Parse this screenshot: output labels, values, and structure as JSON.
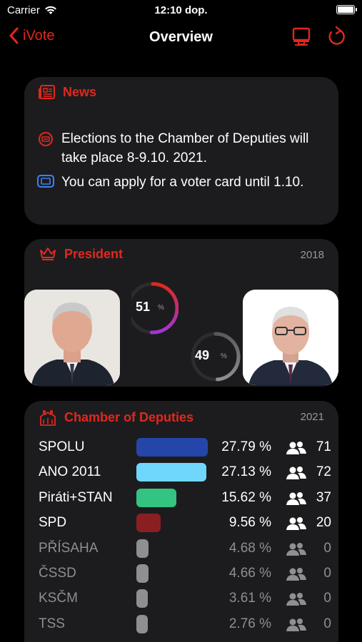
{
  "status_bar": {
    "carrier": "Carrier",
    "time": "12:10 dop."
  },
  "nav": {
    "back_label": "iVote",
    "title": "Overview"
  },
  "news": {
    "title": "News",
    "items": [
      {
        "icon": "ballot-icon",
        "text": "Elections to the Chamber of Deputies will take place 8-9.10. 2021."
      },
      {
        "icon": "voter-card-icon",
        "text": "You can apply for a voter card until 1.10."
      }
    ]
  },
  "president": {
    "title": "President",
    "year": "2018",
    "candidates": [
      {
        "value": "51",
        "unit": "%",
        "share": 0.51,
        "color": "#a035d6"
      },
      {
        "value": "49",
        "unit": "%",
        "share": 0.49,
        "color": "#8e8e93"
      }
    ]
  },
  "chamber": {
    "title": "Chamber of Deputies",
    "year": "2021",
    "parties": [
      {
        "name": "SPOLU",
        "percent": "27.79 %",
        "share": 27.79,
        "seats": "71",
        "color": "#2446a8",
        "dim": false
      },
      {
        "name": "ANO 2011",
        "percent": "27.13 %",
        "share": 27.13,
        "seats": "72",
        "color": "#6fd7fb",
        "dim": false
      },
      {
        "name": "Piráti+STAN",
        "percent": "15.62 %",
        "share": 15.62,
        "seats": "37",
        "color": "#33c482",
        "dim": false
      },
      {
        "name": "SPD",
        "percent": "9.56 %",
        "share": 9.56,
        "seats": "20",
        "color": "#8a1f22",
        "dim": false
      },
      {
        "name": "PŘÍSAHA",
        "percent": "4.68 %",
        "share": 4.68,
        "seats": "0",
        "color": "#8e8e93",
        "dim": true
      },
      {
        "name": "ČSSD",
        "percent": "4.66 %",
        "share": 4.66,
        "seats": "0",
        "color": "#8e8e93",
        "dim": true
      },
      {
        "name": "KSČM",
        "percent": "3.61 %",
        "share": 3.61,
        "seats": "0",
        "color": "#8e8e93",
        "dim": true
      },
      {
        "name": "TSS",
        "percent": "2.76 %",
        "share": 2.76,
        "seats": "0",
        "color": "#8e8e93",
        "dim": true
      }
    ]
  },
  "colors": {
    "accent": "#e0281f",
    "card": "#1c1c1e",
    "background": "#000000"
  }
}
